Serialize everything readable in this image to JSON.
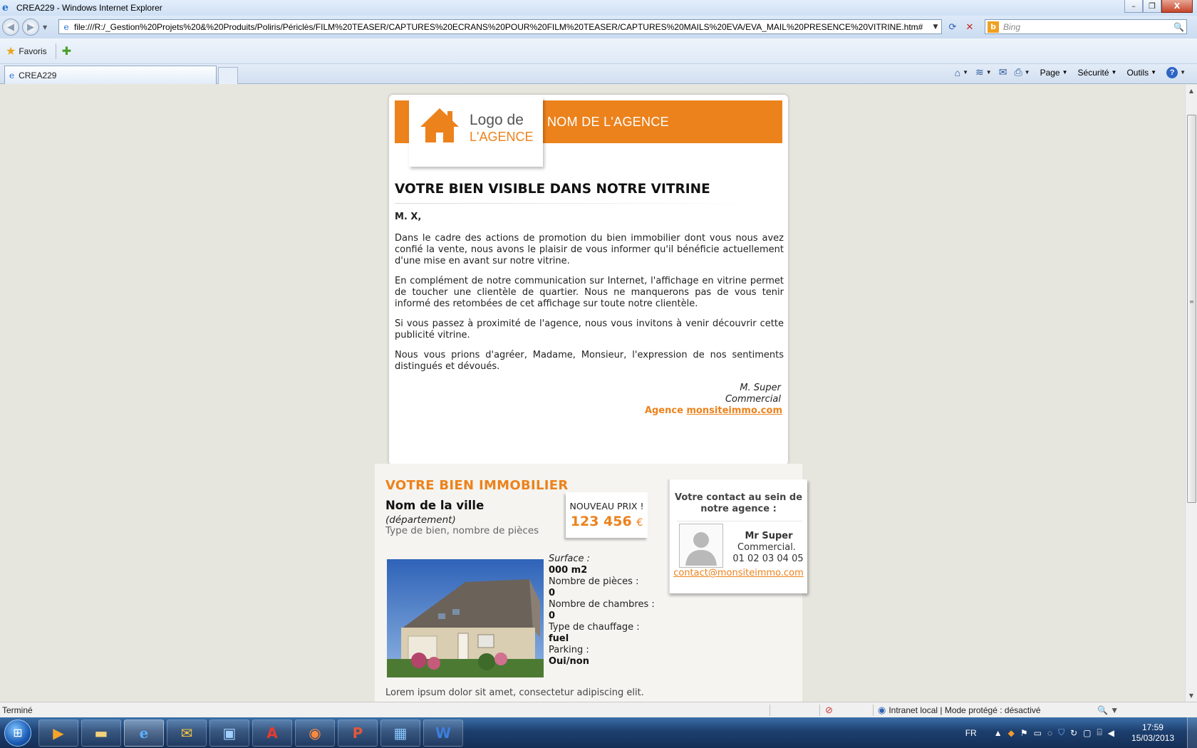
{
  "window": {
    "title": "CREA229 - Windows Internet Explorer",
    "min_glyph": "–",
    "restore_glyph": "❐",
    "close_glyph": "X"
  },
  "address": {
    "url": "file:///R:/_Gestion%20Projets%20&%20Produits/Poliris/Périclès/FILM%20TEASER/CAPTURES%20ECRANS%20POUR%20FILM%20TEASER/CAPTURES%20MAILS%20EVA/EVA_MAIL%20PRESENCE%20VITRINE.htm#",
    "search_placeholder": "Bing"
  },
  "favorites": {
    "label": "Favoris"
  },
  "tab": {
    "label": "CREA229"
  },
  "command_bar": {
    "page": "Page",
    "security": "Sécurité",
    "tools": "Outils",
    "help": "?"
  },
  "email": {
    "logo_line1": "Logo de",
    "logo_line2": "L'AGENCE",
    "agency_name": "NOM DE L'AGENCE",
    "title": "VOTRE BIEN VISIBLE DANS NOTRE VITRINE",
    "salutation": "M. X,",
    "paragraphs": [
      "Dans le cadre des actions de promotion du bien immobilier dont vous nous avez confié la vente, nous avons le plaisir de vous informer qu'il bénéficie actuellement d'une mise en avant sur notre vitrine.",
      "En complément de notre communication sur Internet, l'affichage en vitrine permet de toucher une clientèle de quartier. Nous ne manquerons pas de vous tenir informé des retombées de cet affichage sur toute notre clientèle.",
      "Si vous passez à proximité de l'agence, nous vous invitons à venir découvrir cette publicité vitrine.",
      "Nous vous prions d'agréer, Madame, Monsieur, l'expression de nos sentiments distingués et dévoués."
    ],
    "signature": {
      "name": "M. Super",
      "role": "Commercial",
      "agency_prefix": "Agence",
      "agency_link": "monsiteimmo.com"
    }
  },
  "property": {
    "section_title": "VOTRE BIEN IMMOBILIER",
    "city": "Nom de la ville",
    "department": "(département)",
    "type": "Type de bien, nombre de pièces",
    "price_label": "NOUVEAU PRIX !",
    "price_value": "123 456",
    "price_currency": "€",
    "specs": [
      {
        "label": "Surface :",
        "value": "000 m2"
      },
      {
        "label": "Nombre de pièces :",
        "value": "0"
      },
      {
        "label": "Nombre de chambres :",
        "value": "0"
      },
      {
        "label": "Type de chauffage :",
        "value": "fuel"
      },
      {
        "label": "Parking :",
        "value": "Oui/non"
      }
    ],
    "lorem": "Lorem ipsum dolor sit amet, consectetur adipiscing elit."
  },
  "contact": {
    "title": "Votre contact au sein de notre agence :",
    "name": "Mr Super",
    "role": "Commercial.",
    "phone": "01 02 03 04 05",
    "email": "contact@monsiteimmo.com"
  },
  "statusbar": {
    "status": "Terminé",
    "zone": "Intranet local | Mode protégé : désactivé"
  },
  "taskbar": {
    "language": "FR",
    "time": "17:59",
    "date": "15/03/2013"
  },
  "colors": {
    "accent": "#ec821c"
  }
}
